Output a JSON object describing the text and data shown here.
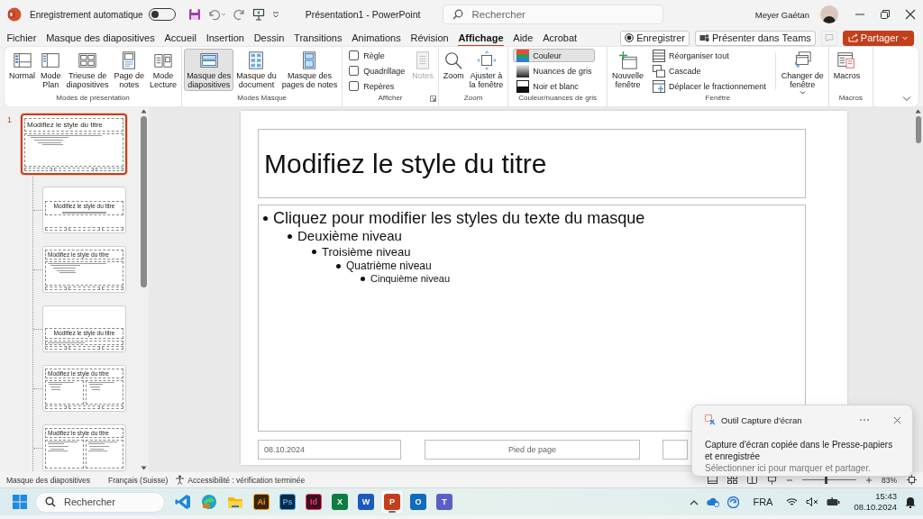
{
  "title_bar": {
    "autosave_label": "Enregistrement automatique",
    "autosave_on": false,
    "title": "Présentation1 - PowerPoint",
    "search_placeholder": "Rechercher",
    "user": "Meyer Gaétan"
  },
  "tabs": [
    {
      "label": "Fichier",
      "selected": false
    },
    {
      "label": "Masque des diapositives",
      "selected": false
    },
    {
      "label": "Accueil",
      "selected": false
    },
    {
      "label": "Insertion",
      "selected": false
    },
    {
      "label": "Dessin",
      "selected": false
    },
    {
      "label": "Transitions",
      "selected": false
    },
    {
      "label": "Animations",
      "selected": false
    },
    {
      "label": "Révision",
      "selected": false
    },
    {
      "label": "Affichage",
      "selected": true
    },
    {
      "label": "Aide",
      "selected": false
    },
    {
      "label": "Acrobat",
      "selected": false
    }
  ],
  "actions": [
    {
      "kind": "record",
      "label": "Enregistrer"
    },
    {
      "kind": "teams",
      "label": "Présenter dans Teams"
    },
    {
      "kind": "comments"
    },
    {
      "kind": "share",
      "label": "Partager"
    }
  ],
  "ribbon": {
    "groups": [
      {
        "label": "Modes de présentation",
        "items": [
          {
            "kind": "large",
            "label": "Normal",
            "selected": false
          },
          {
            "kind": "large",
            "label": "Mode\nPlan",
            "selected": false
          },
          {
            "kind": "large",
            "label": "Trieuse de\ndiapositives",
            "selected": false
          },
          {
            "kind": "large",
            "label": "Page de\nnotes",
            "selected": false
          },
          {
            "kind": "large",
            "label": "Mode\nLecture",
            "selected": false
          }
        ]
      },
      {
        "label": "Modes Masque",
        "items": [
          {
            "kind": "large",
            "label": "Masque des\ndiapositives",
            "selected": true
          },
          {
            "kind": "large",
            "label": "Masque du\ndocument",
            "selected": false
          },
          {
            "kind": "large",
            "label": "Masque des\npages de notes",
            "selected": false
          }
        ]
      },
      {
        "label": "Afficher",
        "launcher": true,
        "items": [
          {
            "kind": "check",
            "label": "Règle",
            "checked": false
          },
          {
            "kind": "check",
            "label": "Quadrillage",
            "checked": false
          },
          {
            "kind": "check",
            "label": "Repères",
            "checked": false
          },
          {
            "kind": "large",
            "label": "Notes",
            "disabled": true
          }
        ]
      },
      {
        "label": "Zoom",
        "items": [
          {
            "kind": "large",
            "label": "Zoom"
          },
          {
            "kind": "large",
            "label": "Ajuster à\nla fenêtre"
          }
        ]
      },
      {
        "label": "Couleur/nuances de gris",
        "items": [
          {
            "kind": "small",
            "label": "Couleur",
            "selected": true
          },
          {
            "kind": "small",
            "label": "Nuances de gris",
            "selected": false
          },
          {
            "kind": "small",
            "label": "Noir et blanc",
            "selected": false
          }
        ]
      },
      {
        "label": "Fenêtre",
        "items": [
          {
            "kind": "large",
            "label": "Nouvelle\nfenêtre"
          },
          {
            "kind": "small",
            "label": "Réorganiser tout"
          },
          {
            "kind": "small",
            "label": "Cascade"
          },
          {
            "kind": "small",
            "label": "Déplacer le fractionnement"
          },
          {
            "kind": "menu",
            "label": "Changer de\nfenêtre"
          }
        ]
      },
      {
        "label": "Macros",
        "items": [
          {
            "kind": "large",
            "label": "Macros"
          }
        ]
      }
    ]
  },
  "thumbnails": [
    {
      "kind": "title-content",
      "number": "1",
      "title": "Modifiez le style du titre",
      "selected": true
    },
    {
      "kind": "title-slide",
      "title": "Modifiez le style du titre",
      "selected": false
    },
    {
      "kind": "title-content",
      "title": "Modifiez le style du titre",
      "selected": false
    },
    {
      "kind": "section",
      "title": "Modifiez le style du titre",
      "selected": false
    },
    {
      "kind": "two-content",
      "title": "Modifiez le style du titre",
      "selected": false
    },
    {
      "kind": "comparison",
      "title": "Modifiez le style du titre",
      "selected": false
    }
  ],
  "slide": {
    "title": "Modifiez le style du titre",
    "body": [
      {
        "text": "Cliquez pour modifier les styles du texte du masque",
        "children": [
          {
            "text": "Deuxième niveau",
            "children": [
              {
                "text": "Troisième niveau",
                "children": [
                  {
                    "text": "Quatrième niveau",
                    "children": [
                      {
                        "text": "Cinquième niveau"
                      }
                    ]
                  }
                ]
              }
            ]
          }
        ]
      }
    ],
    "date": "08.10.2024",
    "footer": "Pied de page"
  },
  "status_bar": {
    "view": "Masque des diapositives",
    "language": "Français (Suisse)",
    "accessibility": "Accessibilité : vérification terminée",
    "zoom": {
      "level": 0.45,
      "reading": "83%"
    }
  },
  "taskbar": {
    "search_placeholder": "Rechercher",
    "apps": [
      {
        "kind": "vscode",
        "active": false
      },
      {
        "kind": "edge",
        "active": false
      },
      {
        "kind": "folder",
        "active": false
      },
      {
        "kind": "adobe",
        "glyph": "Ai",
        "color": "#ff9a00",
        "active": false
      },
      {
        "kind": "adobe",
        "glyph": "Ps",
        "color": "#31a8ff",
        "active": false
      },
      {
        "kind": "adobe",
        "glyph": "Id",
        "color": "#ff3366",
        "active": false
      },
      {
        "kind": "office",
        "glyph": "X",
        "color": "#107c41",
        "active": false
      },
      {
        "kind": "office",
        "glyph": "W",
        "color": "#185abd",
        "active": false
      },
      {
        "kind": "office",
        "glyph": "P",
        "color": "#c43e1c",
        "active": true
      },
      {
        "kind": "office",
        "glyph": "O",
        "color": "#0f6cbd",
        "active": false
      },
      {
        "kind": "office",
        "glyph": "T",
        "color": "#5b5fc7",
        "active": false
      }
    ],
    "tray": {
      "language": "FRA",
      "time": "15:43",
      "date": "08.10.2024"
    }
  },
  "notification": {
    "app": "Outil Capture d'écran",
    "message": "Capture d'écran copiée dans le Presse-papiers et enregistrée",
    "hint": "Sélectionner ici pour marquer et partager."
  }
}
